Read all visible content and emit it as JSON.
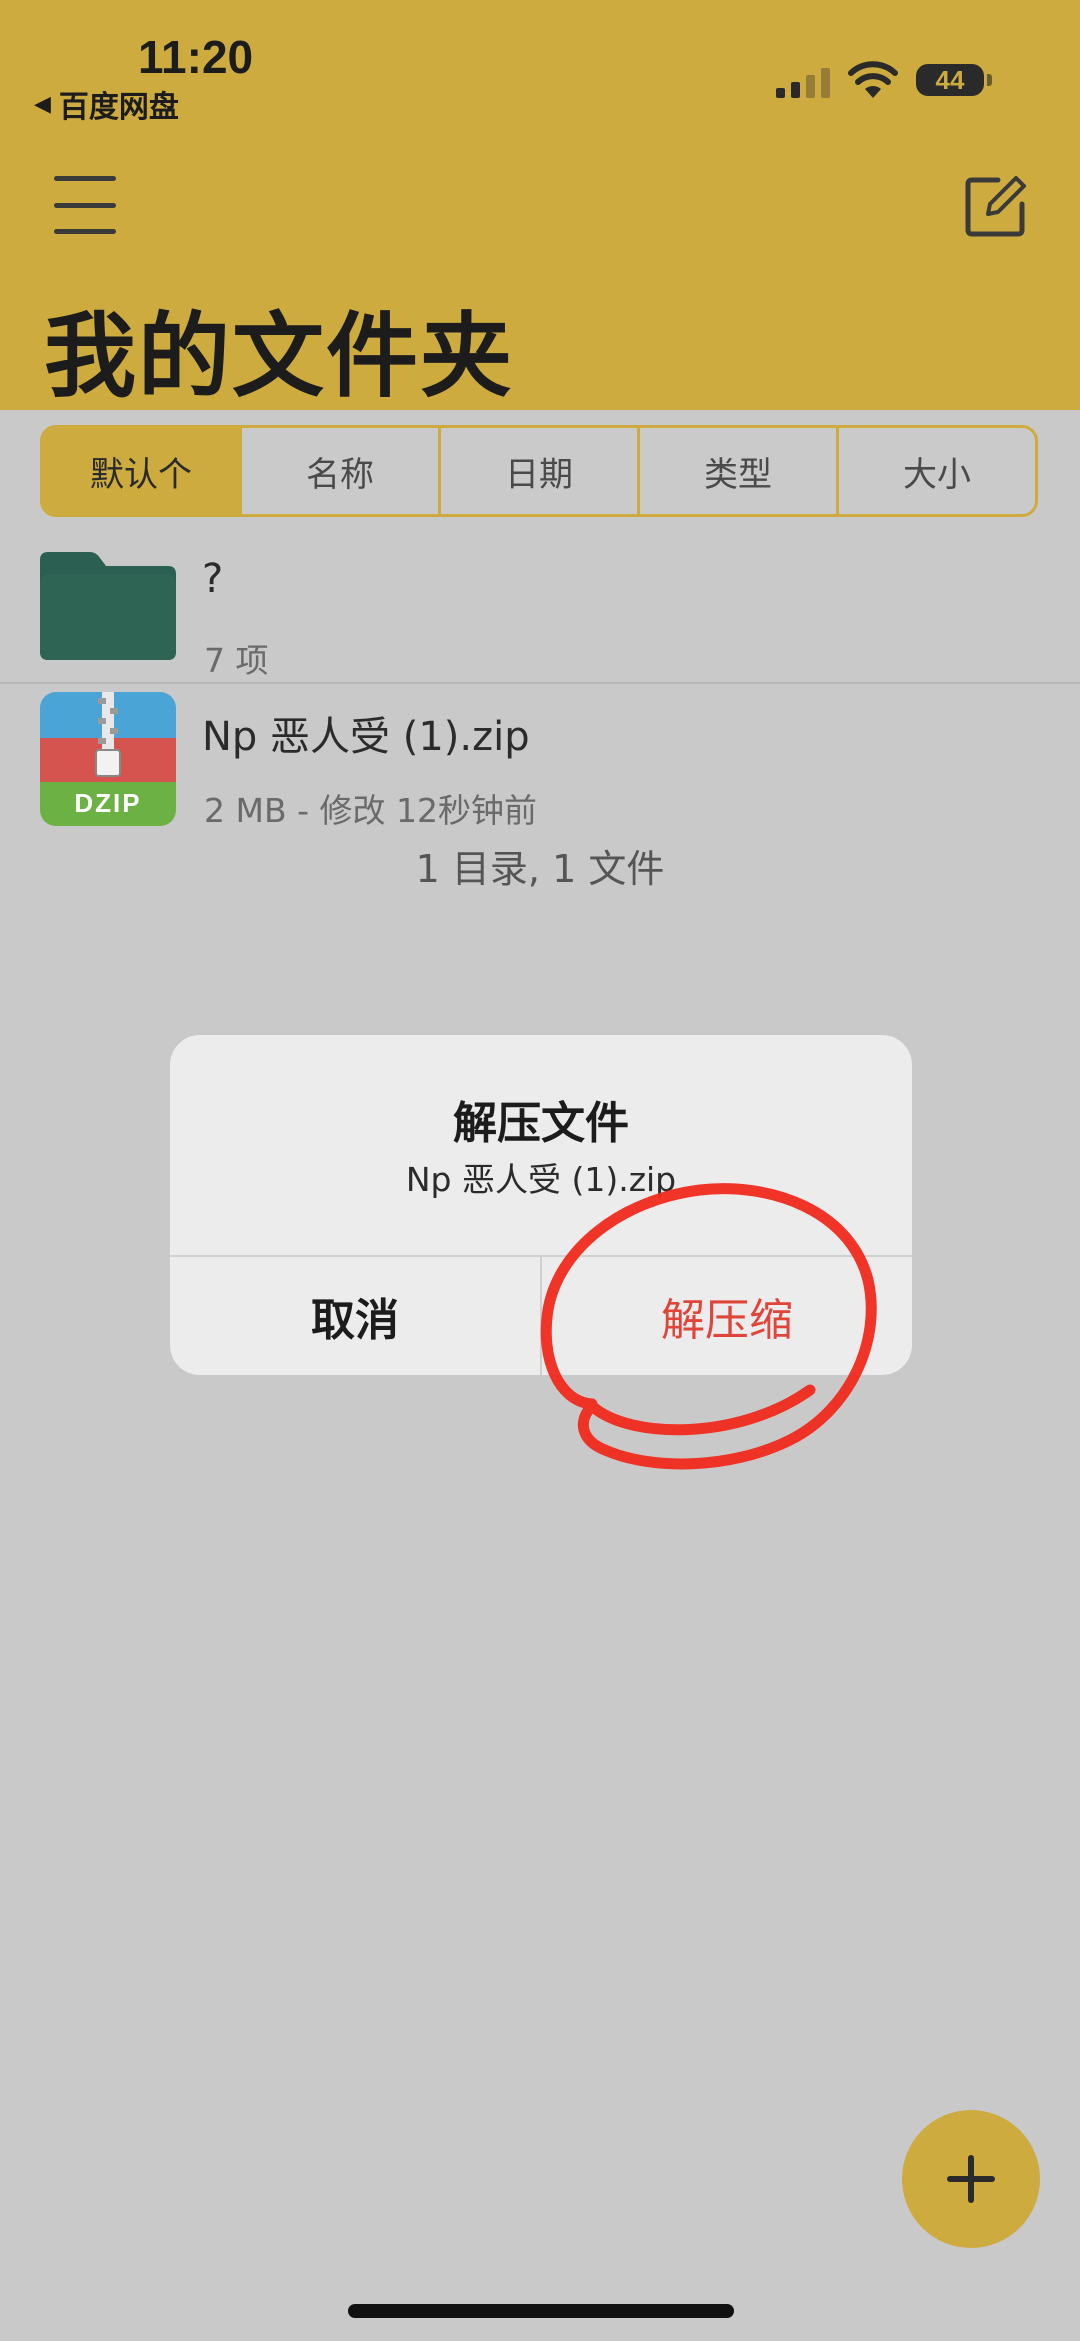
{
  "status_bar": {
    "time": "11:20",
    "back_app": "百度网盘",
    "battery": "44"
  },
  "header": {
    "title": "我的文件夹"
  },
  "sort": {
    "options": [
      "默认个",
      "名称",
      "日期",
      "类型",
      "大小"
    ],
    "active_index": 0
  },
  "files": [
    {
      "name": "?",
      "subtitle": "7 项",
      "type": "folder",
      "icon_color": "#2a5f51"
    },
    {
      "name": "Np 恶人受 (1).zip",
      "subtitle": "2 MB - 修改 12秒钟前",
      "type": "zip",
      "icon_label": "DZIP"
    }
  ],
  "summary": "1 目录, 1 文件",
  "dialog": {
    "title": "解压文件",
    "message": "Np 恶人受 (1).zip",
    "cancel_label": "取消",
    "confirm_label": "解压缩"
  },
  "colors": {
    "accent": "#cdab3f",
    "destructive": "#e0453a",
    "annotation": "#f02a1e"
  }
}
